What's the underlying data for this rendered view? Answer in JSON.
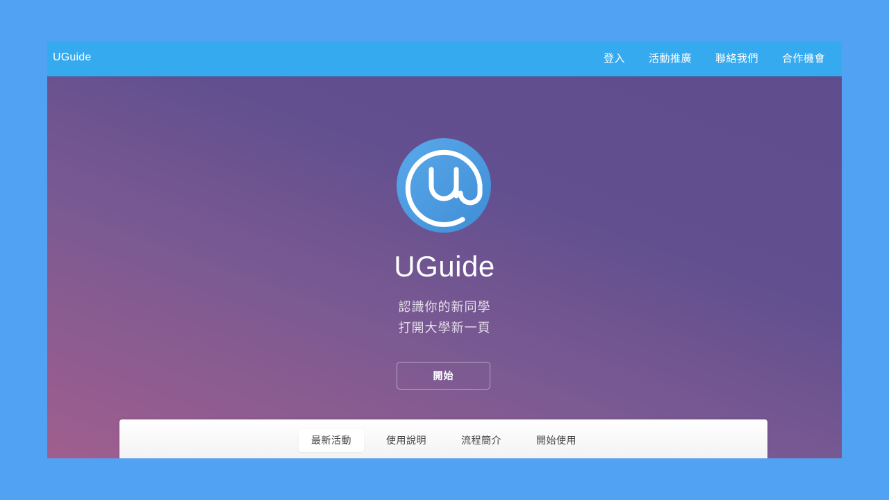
{
  "navbar": {
    "brand": "UGuide",
    "links": [
      "登入",
      "活動推廣",
      "聯絡我們",
      "合作機會"
    ]
  },
  "hero": {
    "logo_icon": "uguide-logo-icon",
    "title": "UGuide",
    "subtitle_line1": "認識你的新同學",
    "subtitle_line2": "打開大學新一頁",
    "start_button": "開始"
  },
  "tabs": {
    "items": [
      "最新活動",
      "使用說明",
      "流程簡介",
      "開始使用"
    ],
    "active": "最新活動"
  },
  "colors": {
    "page_background": "#52a2f3",
    "navbar": "#35aaef",
    "logo_blue": "#4a9be0",
    "hero_gradient_start": "#a05e8e",
    "hero_gradient_end": "#5e4c8d"
  }
}
